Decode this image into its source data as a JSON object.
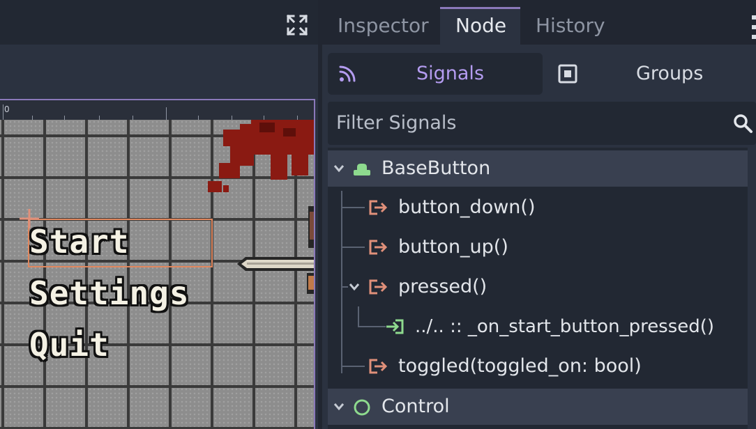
{
  "dock": {
    "tabs": [
      {
        "label": "Inspector",
        "active": false
      },
      {
        "label": "Node",
        "active": true
      },
      {
        "label": "History",
        "active": false
      }
    ],
    "modes": {
      "signals_label": "Signals",
      "groups_label": "Groups",
      "selected": "Signals"
    },
    "filter": {
      "placeholder": "Filter Signals",
      "value": ""
    },
    "tree": [
      {
        "kind": "category",
        "label": "BaseButton",
        "icon": "base-button-icon",
        "expanded": true
      },
      {
        "kind": "signal",
        "label": "button_down()",
        "icon": "signal-icon"
      },
      {
        "kind": "signal",
        "label": "button_up()",
        "icon": "signal-icon"
      },
      {
        "kind": "signal",
        "label": "pressed()",
        "icon": "signal-icon",
        "expanded": true
      },
      {
        "kind": "connection",
        "label": "../.. :: _on_start_button_pressed()",
        "icon": "slot-icon"
      },
      {
        "kind": "signal",
        "label": "toggled(toggled_on: bool)",
        "icon": "signal-icon"
      },
      {
        "kind": "category",
        "label": "Control",
        "icon": "control-icon",
        "expanded": true
      }
    ]
  },
  "viewport": {
    "ruler_zero": "0",
    "menu": [
      "Start",
      "Settings",
      "Quit"
    ]
  },
  "colors": {
    "accent": "#8b79ba",
    "signal_icon": "#e0907a",
    "slot_icon": "#8eda8e",
    "selection_rect": "#e0875e",
    "blood": "#8a1a12"
  }
}
